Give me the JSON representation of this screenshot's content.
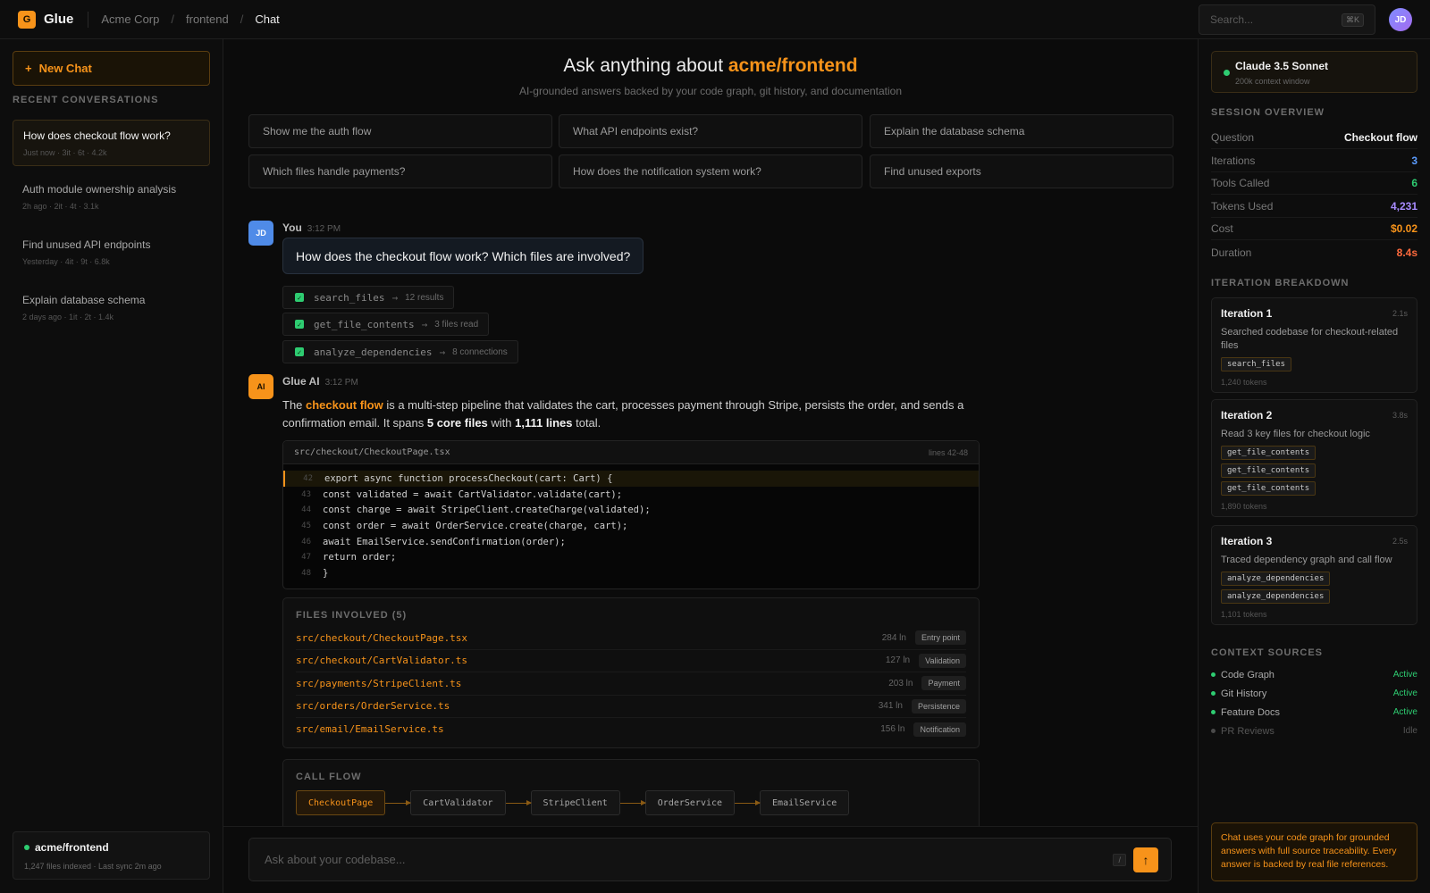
{
  "topbar": {
    "logo_letter": "G",
    "app_name": "Glue",
    "breadcrumb": [
      "Acme Corp",
      "frontend",
      "Chat"
    ],
    "search_placeholder": "Search...",
    "search_shortcut": "⌘K",
    "user_initials": "JD"
  },
  "sidebar": {
    "new_chat_label": "New Chat",
    "recent_label": "RECENT CONVERSATIONS",
    "conversations": [
      {
        "title": "How does checkout flow work?",
        "meta": "Just now  ·  3it  ·  6t  ·  4.2k",
        "active": true
      },
      {
        "title": "Auth module ownership analysis",
        "meta": "2h ago  ·  2it  ·  4t  ·  3.1k",
        "active": false
      },
      {
        "title": "Find unused API endpoints",
        "meta": "Yesterday  ·  4it  ·  9t  ·  6.8k",
        "active": false
      },
      {
        "title": "Explain database schema",
        "meta": "2 days ago  ·  1it  ·  2t  ·  1.4k",
        "active": false
      }
    ],
    "repo": {
      "name": "acme/frontend",
      "meta": "1,247 files indexed · Last sync 2m ago"
    }
  },
  "main": {
    "hero_prefix": "Ask anything about ",
    "hero_repo": "acme/frontend",
    "hero_sub": "AI-grounded answers backed by your code graph, git history, and documentation",
    "suggestions": [
      "Show me the auth flow",
      "What API endpoints exist?",
      "Explain the database schema",
      "Which files handle payments?",
      "How does the notification system work?",
      "Find unused exports"
    ],
    "user_msg": {
      "avatar": "JD",
      "author": "You",
      "time": "3:12 PM",
      "text": "How does the checkout flow work? Which files are involved?"
    },
    "tool_calls": [
      {
        "name": "search_files",
        "arrow": "→",
        "result": "12 results"
      },
      {
        "name": "get_file_contents",
        "arrow": "→",
        "result": "3 files read"
      },
      {
        "name": "analyze_dependencies",
        "arrow": "→",
        "result": "8 connections"
      }
    ],
    "ai_msg": {
      "avatar": "AI",
      "author": "Glue AI",
      "time": "3:12 PM",
      "t1": "The ",
      "t2": "checkout flow",
      "t3": " is a multi-step pipeline that validates the cart, processes payment through Stripe, persists the order, and sends a confirmation email. It spans ",
      "t4": "5 core files",
      "t5": " with ",
      "t6": "1,111 lines",
      "t7": " total."
    },
    "code": {
      "file": "src/checkout/CheckoutPage.tsx",
      "range": "lines 42-48",
      "lines": [
        {
          "n": "42",
          "code": "export async function processCheckout(cart: Cart) {"
        },
        {
          "n": "43",
          "code": "const validated = await CartValidator.validate(cart);"
        },
        {
          "n": "44",
          "code": "const charge = await StripeClient.createCharge(validated);"
        },
        {
          "n": "45",
          "code": "const order = await OrderService.create(charge, cart);"
        },
        {
          "n": "46",
          "code": "await EmailService.sendConfirmation(order);"
        },
        {
          "n": "47",
          "code": "return order;"
        },
        {
          "n": "48",
          "code": "}"
        }
      ]
    },
    "files": {
      "label": "FILES INVOLVED (5)",
      "rows": [
        {
          "path": "src/checkout/CheckoutPage.tsx",
          "lines": "284 ln",
          "tag": "Entry point"
        },
        {
          "path": "src/checkout/CartValidator.ts",
          "lines": "127 ln",
          "tag": "Validation"
        },
        {
          "path": "src/payments/StripeClient.ts",
          "lines": "203 ln",
          "tag": "Payment"
        },
        {
          "path": "src/orders/OrderService.ts",
          "lines": "341 ln",
          "tag": "Persistence"
        },
        {
          "path": "src/email/EmailService.ts",
          "lines": "156 ln",
          "tag": "Notification"
        }
      ]
    },
    "call_flow": {
      "label": "CALL FLOW",
      "nodes": [
        "CheckoutPage",
        "CartValidator",
        "StripeClient",
        "OrderService",
        "EmailService"
      ]
    },
    "composer": {
      "placeholder": "Ask about your codebase...",
      "shortcut": "/",
      "send_icon": "↑"
    }
  },
  "rsidebar": {
    "model": {
      "name": "Claude 3.5 Sonnet",
      "sub": "200k context window"
    },
    "session_label": "SESSION OVERVIEW",
    "stats": [
      {
        "k": "Question",
        "v": "Checkout flow",
        "color": "#f2f2f2"
      },
      {
        "k": "Iterations",
        "v": "3",
        "color": "#5b9cff"
      },
      {
        "k": "Tools Called",
        "v": "6",
        "color": "#2ecc71"
      },
      {
        "k": "Tokens Used",
        "v": "4,231",
        "color": "#a88bff"
      },
      {
        "k": "Cost",
        "v": "$0.02",
        "color": "#f7931a"
      },
      {
        "k": "Duration",
        "v": "8.4s",
        "color": "#ff6a3d"
      }
    ],
    "iter_label": "ITERATION BREAKDOWN",
    "iterations": [
      {
        "title": "Iteration 1",
        "time": "2.1s",
        "desc": "Searched codebase for checkout-related files",
        "tools": [
          "search_files"
        ],
        "tokens": "1,240 tokens"
      },
      {
        "title": "Iteration 2",
        "time": "3.8s",
        "desc": "Read 3 key files for checkout logic",
        "tools": [
          "get_file_contents",
          "get_file_contents",
          "get_file_contents"
        ],
        "tokens": "1,890 tokens"
      },
      {
        "title": "Iteration 3",
        "time": "2.5s",
        "desc": "Traced dependency graph and call flow",
        "tools": [
          "analyze_dependencies",
          "analyze_dependencies"
        ],
        "tokens": "1,101 tokens"
      }
    ],
    "ctx_label": "CONTEXT SOURCES",
    "sources": [
      {
        "name": "Code Graph",
        "state": "Active",
        "active": true
      },
      {
        "name": "Git History",
        "state": "Active",
        "active": true
      },
      {
        "name": "Feature Docs",
        "state": "Active",
        "active": true
      },
      {
        "name": "PR Reviews",
        "state": "Idle",
        "active": false
      }
    ],
    "note": "Chat uses your code graph for grounded answers with full source traceability. Every answer is backed by real file references."
  }
}
